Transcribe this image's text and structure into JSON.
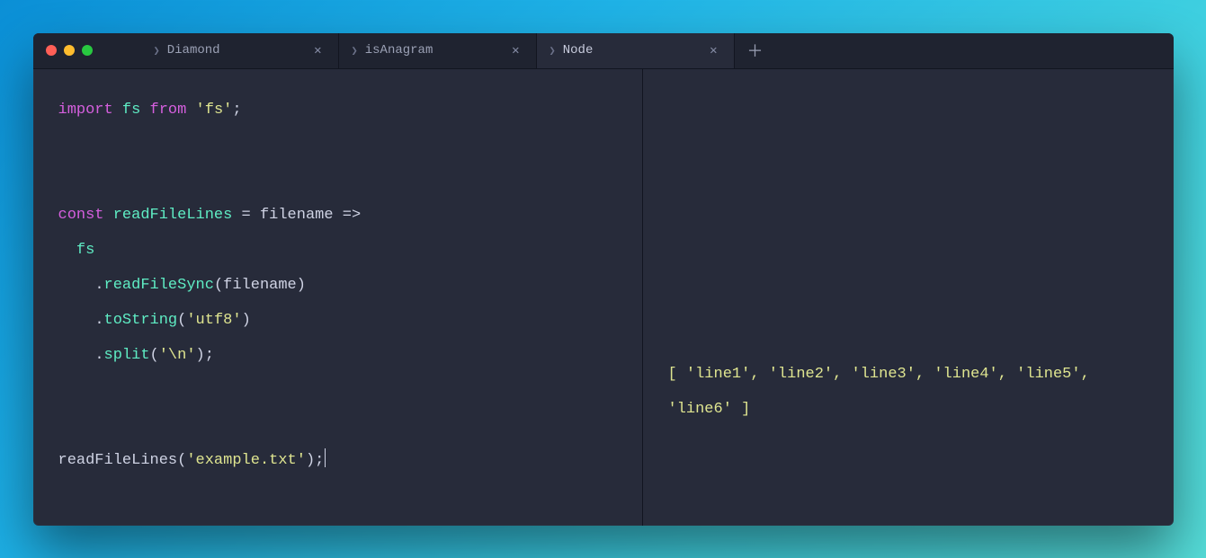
{
  "tabs": [
    {
      "label": "Diamond"
    },
    {
      "label": "isAnagram"
    },
    {
      "label": "Node"
    }
  ],
  "code": {
    "kw_import": "import",
    "ident_fs": "fs",
    "kw_from": "from",
    "str_fs": "'fs'",
    "semi": ";",
    "kw_const": "const",
    "ident_readFileLines": "readFileLines",
    "eq": "=",
    "param_filename": "filename",
    "arrow": "=>",
    "ident_fs2": "fs",
    "dot": ".",
    "m_readFileSync": "readFileSync",
    "lp": "(",
    "arg_filename": "filename",
    "rp": ")",
    "m_toString": "toString",
    "str_utf8": "'utf8'",
    "m_split": "split",
    "str_nl": "'\\n'",
    "call_readFileLines": "readFileLines",
    "str_example": "'example.txt'"
  },
  "output": "[ 'line1', 'line2', 'line3', 'line4', 'line5', 'line6' ]"
}
